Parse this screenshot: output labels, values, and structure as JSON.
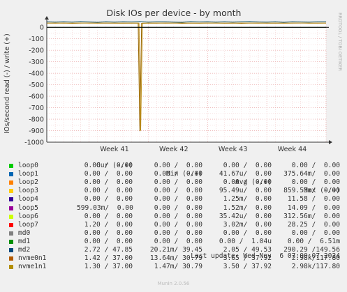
{
  "chart_data": {
    "type": "line",
    "title": "Disk IOs per device - by month",
    "ylabel": "IOs/second read (-) / write (+)",
    "watermark": "RRDTOOL / TOBI OETIKER",
    "ylim": [
      -1000,
      50
    ],
    "y_ticks": [
      {
        "v": 0,
        "label": "0"
      },
      {
        "v": -100,
        "label": "-100"
      },
      {
        "v": -200,
        "label": "-200"
      },
      {
        "v": -300,
        "label": "-300"
      },
      {
        "v": -400,
        "label": "-400"
      },
      {
        "v": -500,
        "label": "-500"
      },
      {
        "v": -600,
        "label": "-600"
      },
      {
        "v": -700,
        "label": "-700"
      },
      {
        "v": -800,
        "label": "-800"
      },
      {
        "v": -900,
        "label": "-900"
      },
      {
        "v": -1000,
        "label": "-1000"
      }
    ],
    "xlim": [
      0,
      33
    ],
    "x_ticks": [
      {
        "v": 8,
        "label": "Week 41"
      },
      {
        "v": 15,
        "label": "Week 42"
      },
      {
        "v": 22,
        "label": "Week 43"
      },
      {
        "v": 29,
        "label": "Week 44"
      }
    ],
    "series": [
      {
        "name": "md2",
        "color": "#004b66",
        "x": [
          0,
          1,
          2,
          3,
          4,
          5,
          6,
          7,
          8,
          9,
          10,
          11,
          12,
          13,
          14,
          15,
          16,
          17,
          18,
          19,
          20,
          21,
          22,
          23,
          24,
          25,
          26,
          27,
          28,
          29,
          30,
          31,
          32,
          33
        ],
        "values": [
          48,
          46,
          49,
          45,
          50,
          47,
          44,
          48,
          46,
          49,
          47,
          50,
          45,
          48,
          49,
          46,
          44,
          50,
          47,
          48,
          46,
          49,
          45,
          48,
          50,
          47,
          46,
          49,
          44,
          48,
          47,
          46,
          49,
          48
        ]
      },
      {
        "name": "nvme0n1",
        "color": "#996600",
        "x": [
          0,
          1,
          2,
          3,
          4,
          5,
          6,
          7,
          8,
          9,
          10,
          10.8,
          11,
          11.2,
          12,
          13,
          14,
          15,
          16,
          17,
          18,
          19,
          20,
          21,
          22,
          23,
          24,
          25,
          26,
          27,
          28,
          29,
          30,
          31,
          32,
          33
        ],
        "values": [
          37,
          36,
          38,
          35,
          37,
          38,
          36,
          37,
          36,
          37,
          36,
          36,
          -905,
          35,
          37,
          36,
          38,
          37,
          35,
          37,
          36,
          38,
          37,
          36,
          37,
          35,
          37,
          38,
          36,
          37,
          36,
          37,
          38,
          36,
          37,
          37
        ]
      },
      {
        "name": "nvme1n1",
        "color": "#bd8e1b",
        "x": [
          0,
          1,
          2,
          3,
          4,
          5,
          6,
          7,
          8,
          9,
          10,
          10.9,
          11.1,
          11.3,
          12,
          13,
          14,
          15,
          16,
          17,
          18,
          19,
          20,
          21,
          22,
          23,
          24,
          25,
          26,
          27,
          28,
          29,
          30,
          31,
          32,
          33
        ],
        "values": [
          37,
          38,
          36,
          37,
          38,
          36,
          37,
          38,
          37,
          36,
          38,
          37,
          -900,
          36,
          37,
          38,
          36,
          37,
          38,
          37,
          36,
          37,
          38,
          36,
          37,
          38,
          37,
          36,
          37,
          38,
          36,
          37,
          38,
          37,
          36,
          37
        ]
      },
      {
        "name": "md1",
        "color": "#003300",
        "x": [
          0,
          33
        ],
        "values": [
          0,
          0
        ]
      }
    ]
  },
  "legend": {
    "header": {
      "cur": "Cur (-/+)",
      "min": "Min (-/+)",
      "avg": "Avg (-/+)",
      "max": "Max (-/+)"
    },
    "rows": [
      {
        "name": "loop0",
        "color": "#00cc00",
        "cur": "0.00 /  0.00",
        "min": "0.00 /  0.00",
        "avg": "0.00 /  0.00",
        "max": "0.00 /  0.00"
      },
      {
        "name": "loop1",
        "color": "#0066b3",
        "cur": "0.00 /  0.00",
        "min": "0.00 /  0.00",
        "avg": "41.67u/  0.00",
        "max": "375.64m/  0.00"
      },
      {
        "name": "loop2",
        "color": "#ff8000",
        "cur": "0.00 /  0.00",
        "min": "0.00 /  0.00",
        "avg": "0.00 /  0.00",
        "max": "0.00 /  0.00"
      },
      {
        "name": "loop3",
        "color": "#ffcc00",
        "cur": "0.00 /  0.00",
        "min": "0.00 /  0.00",
        "avg": "95.49u/  0.00",
        "max": "859.53m/  0.00"
      },
      {
        "name": "loop4",
        "color": "#330099",
        "cur": "0.00 /  0.00",
        "min": "0.00 /  0.00",
        "avg": "1.25m/  0.00",
        "max": "11.58 /  0.00"
      },
      {
        "name": "loop5",
        "color": "#990099",
        "cur": "599.03m/  0.00",
        "min": "0.00 /  0.00",
        "avg": "1.52m/  0.00",
        "max": "14.09 /  0.00"
      },
      {
        "name": "loop6",
        "color": "#ccff00",
        "cur": "0.00 /  0.00",
        "min": "0.00 /  0.00",
        "avg": "35.42u/  0.00",
        "max": "312.56m/  0.00"
      },
      {
        "name": "loop7",
        "color": "#ff0000",
        "cur": "1.20 /  0.00",
        "min": "0.00 /  0.00",
        "avg": "3.02m/  0.00",
        "max": "28.25 /  0.00"
      },
      {
        "name": "md0",
        "color": "#808080",
        "cur": "0.00 /  0.00",
        "min": "0.00 /  0.00",
        "avg": "0.00 /  0.00",
        "max": "0.00 /  0.00"
      },
      {
        "name": "md1",
        "color": "#008f00",
        "cur": "0.00 /  0.00",
        "min": "0.00 /  0.00",
        "avg": "0.00 /  1.04u",
        "max": "0.00 /  6.51m"
      },
      {
        "name": "md2",
        "color": "#00487d",
        "cur": "2.72 / 47.85",
        "min": "20.21m/ 39.45",
        "avg": "2.05 / 49.53",
        "max": "290.29 /149.56"
      },
      {
        "name": "nvme0n1",
        "color": "#b35a00",
        "cur": "1.42 / 37.00",
        "min": "13.64m/ 30.79",
        "avg": "3.65 / 37.92",
        "max": "2.98k/117.80"
      },
      {
        "name": "nvme1n1",
        "color": "#b38f00",
        "cur": "1.30 / 37.00",
        "min": "1.47m/ 30.79",
        "avg": "3.50 / 37.92",
        "max": "2.98k/117.80"
      }
    ]
  },
  "footer": {
    "last_update": "Last update: Wed Nov  6 07:00:07 2024",
    "munin_version": "Munin 2.0.56"
  }
}
